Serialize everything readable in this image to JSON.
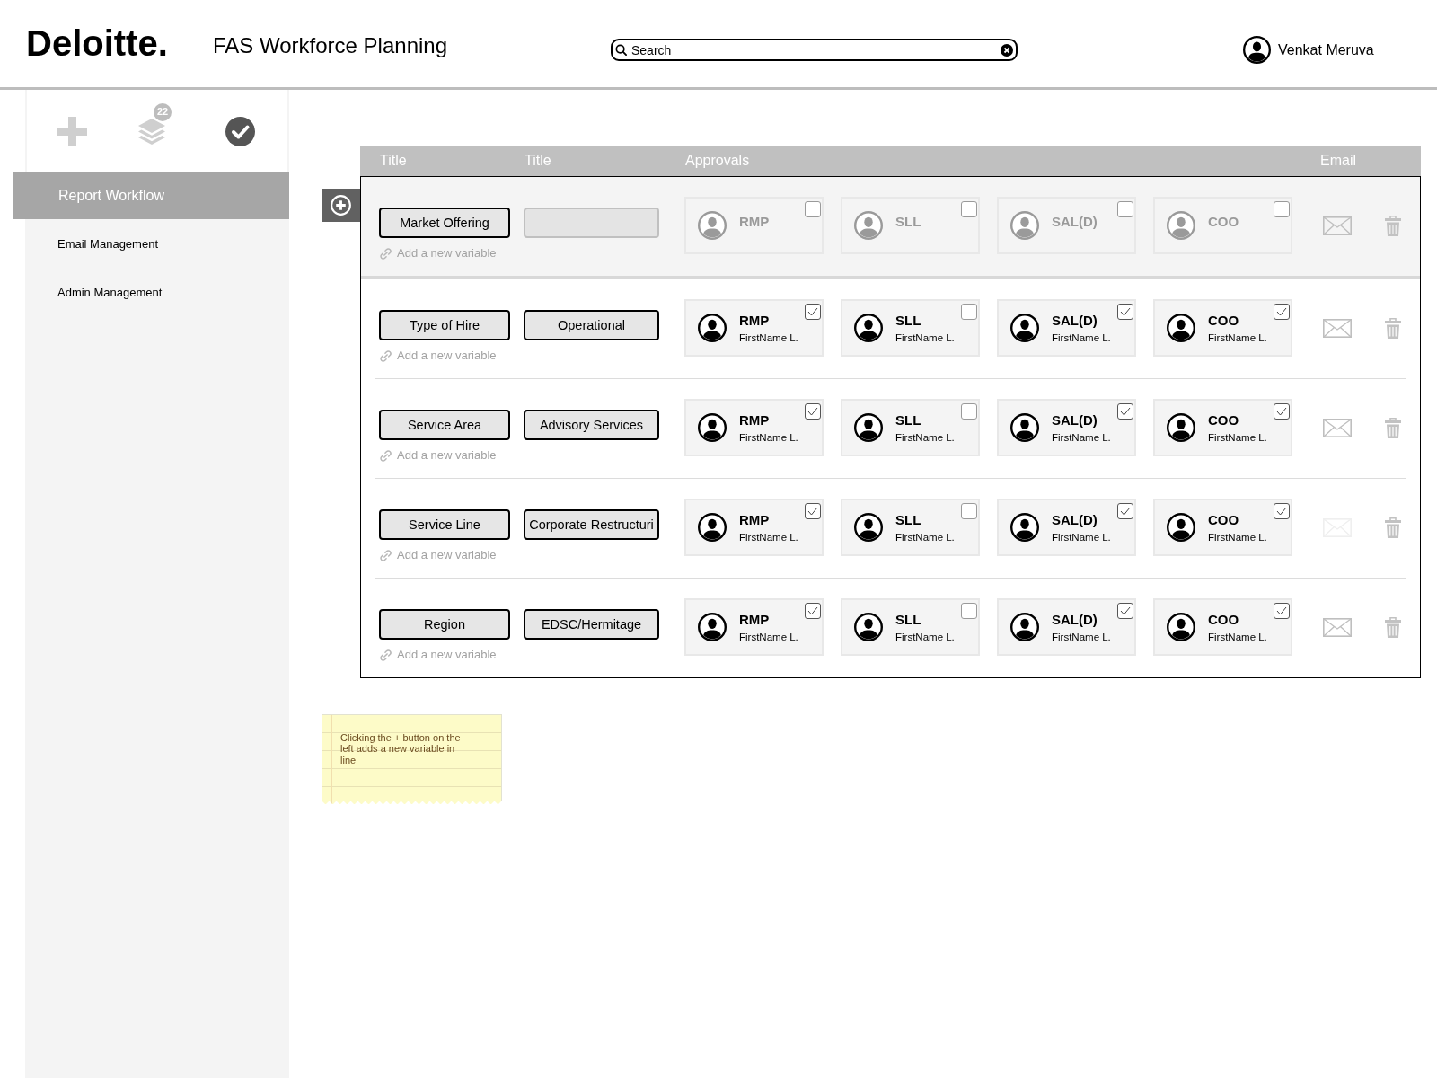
{
  "header": {
    "logo": "Deloitte.",
    "title": "FAS Workforce Planning",
    "search": {
      "placeholder": "Search"
    },
    "user": {
      "name": "Venkat Meruva"
    }
  },
  "sidebar": {
    "toolbar": [
      {
        "kind": "add",
        "disabled": true
      },
      {
        "kind": "layers",
        "disabled": true,
        "badge": "22"
      },
      {
        "kind": "approve",
        "disabled": false
      }
    ],
    "items": [
      {
        "label": "Report Workflow",
        "selected": true
      },
      {
        "label": "Email Management",
        "selected": false
      },
      {
        "label": "Admin Management",
        "selected": false
      }
    ]
  },
  "table": {
    "columns": [
      "Title",
      "Title",
      "Approvals",
      "Email"
    ],
    "rows": [
      {
        "selected": true,
        "variable": "Market Offering",
        "add_link": "Add a new variable",
        "email_disabled": false,
        "approvers": [
          {
            "role": "RMP",
            "assigned": false,
            "checked": false
          },
          {
            "role": "SLL",
            "assigned": false,
            "checked": false
          },
          {
            "role": "SAL(D)",
            "assigned": false,
            "checked": false
          },
          {
            "role": "COO",
            "assigned": false,
            "checked": false
          }
        ]
      },
      {
        "selected": false,
        "variable": "Type of Hire",
        "value": "Operational",
        "add_link": "Add a new variable",
        "email_disabled": false,
        "approvers": [
          {
            "role": "RMP",
            "name": "FirstName L.",
            "assigned": true,
            "checked": true
          },
          {
            "role": "SLL",
            "name": "FirstName L.",
            "assigned": true,
            "checked": false
          },
          {
            "role": "SAL(D)",
            "name": "FirstName L.",
            "assigned": true,
            "checked": true
          },
          {
            "role": "COO",
            "name": "FirstName L.",
            "assigned": true,
            "checked": true
          }
        ]
      },
      {
        "selected": false,
        "variable": "Service Area",
        "value": "Advisory Services",
        "add_link": "Add a new variable",
        "email_disabled": false,
        "approvers": [
          {
            "role": "RMP",
            "name": "FirstName L.",
            "assigned": true,
            "checked": true
          },
          {
            "role": "SLL",
            "name": "FirstName L.",
            "assigned": true,
            "checked": false
          },
          {
            "role": "SAL(D)",
            "name": "FirstName L.",
            "assigned": true,
            "checked": true
          },
          {
            "role": "COO",
            "name": "FirstName L.",
            "assigned": true,
            "checked": true
          }
        ]
      },
      {
        "selected": false,
        "variable": "Service Line",
        "value": "Corporate Restructuri",
        "add_link": "Add a new variable",
        "email_disabled": true,
        "approvers": [
          {
            "role": "RMP",
            "name": "FirstName L.",
            "assigned": true,
            "checked": true
          },
          {
            "role": "SLL",
            "name": "FirstName L.",
            "assigned": true,
            "checked": false
          },
          {
            "role": "SAL(D)",
            "name": "FirstName L.",
            "assigned": true,
            "checked": true
          },
          {
            "role": "COO",
            "name": "FirstName L.",
            "assigned": true,
            "checked": true
          }
        ]
      },
      {
        "selected": false,
        "variable": "Region",
        "value": "EDSC/Hermitage",
        "add_link": "Add a new variable",
        "email_disabled": false,
        "approvers": [
          {
            "role": "RMP",
            "name": "FirstName L.",
            "assigned": true,
            "checked": true
          },
          {
            "role": "SLL",
            "name": "FirstName L.",
            "assigned": true,
            "checked": false
          },
          {
            "role": "SAL(D)",
            "name": "FirstName L.",
            "assigned": true,
            "checked": true
          },
          {
            "role": "COO",
            "name": "FirstName L.",
            "assigned": true,
            "checked": true
          }
        ]
      }
    ]
  },
  "note": {
    "text": "Clicking the + button on the left adds a new variable in line"
  }
}
